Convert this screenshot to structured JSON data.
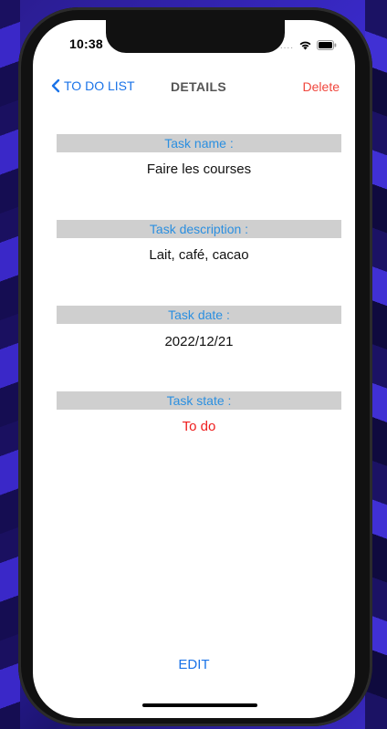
{
  "status_bar": {
    "time": "10:38",
    "signal_dots": "....",
    "icons": [
      "wifi-icon",
      "battery-icon"
    ]
  },
  "nav": {
    "back_label": "TO DO LIST",
    "title": "DETAILS",
    "delete_label": "Delete"
  },
  "fields": [
    {
      "label": "Task name :",
      "value": "Faire les courses"
    },
    {
      "label": "Task description :",
      "value": "Lait, café, cacao"
    },
    {
      "label": "Task date :",
      "value": "2022/12/21"
    },
    {
      "label": "Task state :",
      "value": "To do"
    }
  ],
  "edit_label": "EDIT",
  "colors": {
    "accent_blue": "#1a73e8",
    "header_text_blue": "#2b8fe0",
    "header_background": "#cfcfcf",
    "delete_red": "#f0463c",
    "state_red": "#ee1c1c"
  }
}
